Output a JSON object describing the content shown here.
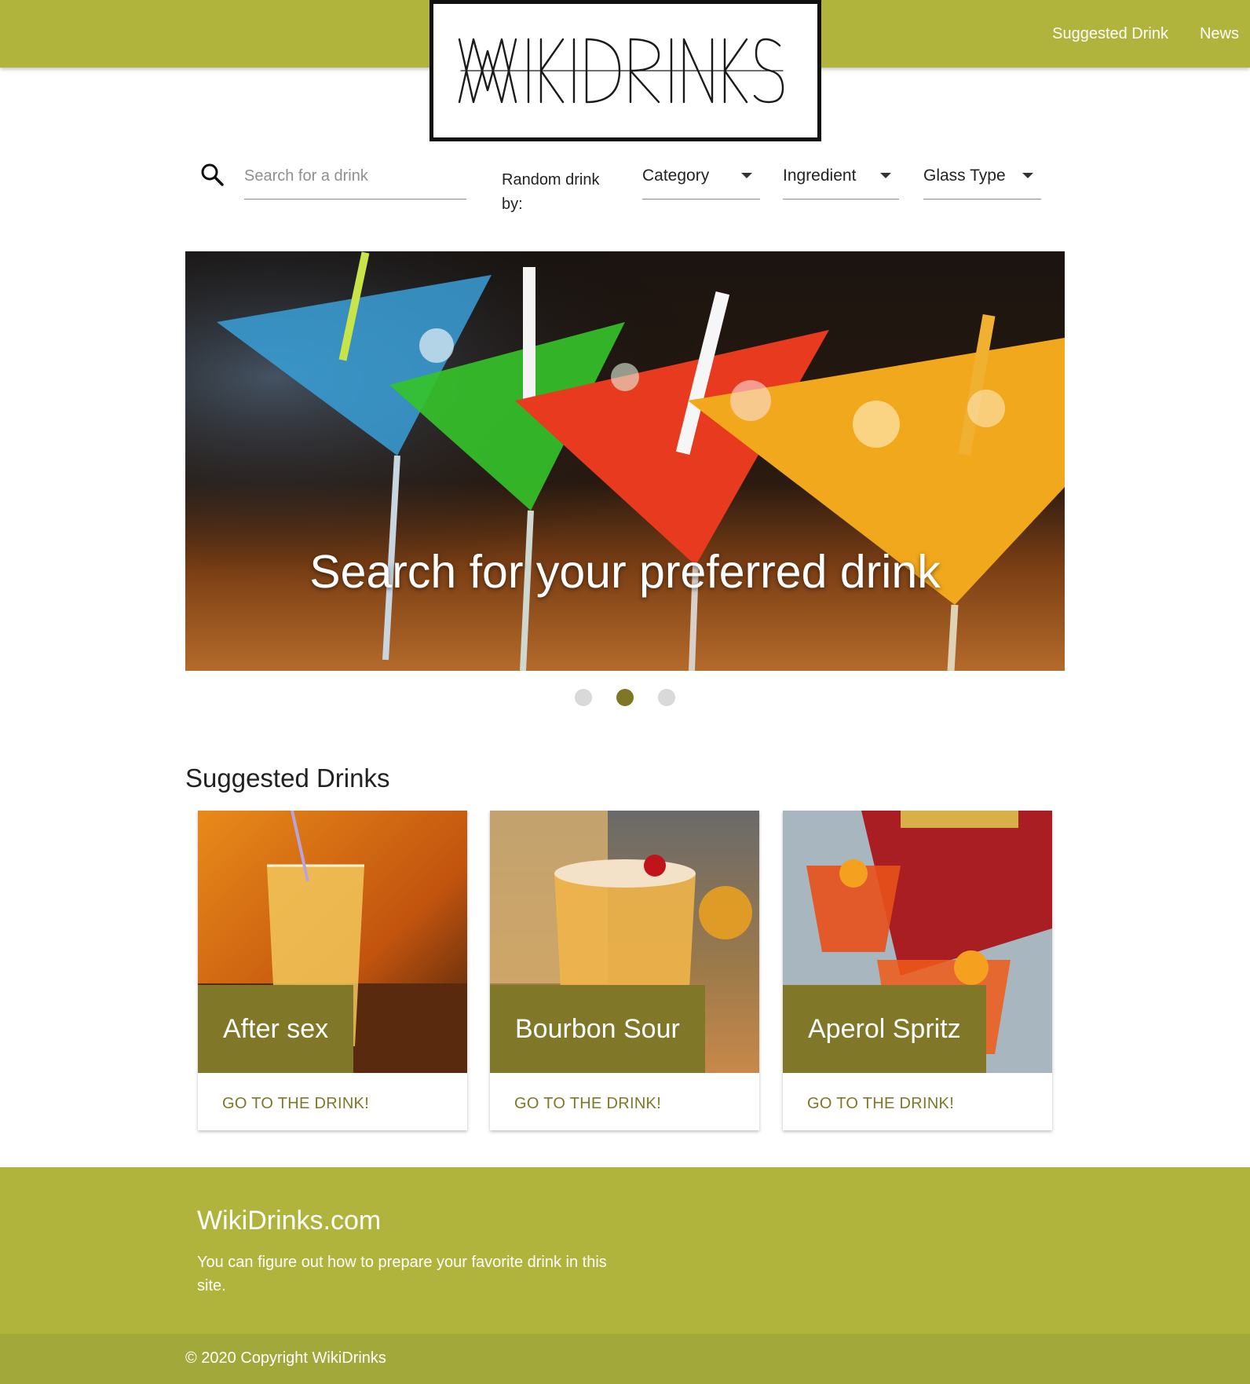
{
  "nav": {
    "links": [
      "Suggested Drink",
      "News"
    ]
  },
  "logo": {
    "text": "WIKIDRINKS"
  },
  "search": {
    "placeholder": "Search for a drink"
  },
  "random": {
    "label": "Random drink by:",
    "dropdowns": [
      "Category",
      "Ingredient",
      "Glass Type"
    ]
  },
  "hero": {
    "caption": "Search for your preferred drink",
    "slide_count": 3,
    "active_slide": 2
  },
  "suggested": {
    "title": "Suggested Drinks",
    "cards": [
      {
        "name": "After sex",
        "action": "GO TO THE DRINK!"
      },
      {
        "name": "Bourbon Sour",
        "action": "GO TO THE DRINK!"
      },
      {
        "name": "Aperol Spritz",
        "action": "GO TO THE DRINK!"
      }
    ]
  },
  "footer": {
    "title": "WikiDrinks.com",
    "text": "You can figure out how to prepare your favorite drink in this site.",
    "copyright": "© 2020 Copyright WikiDrinks"
  },
  "colors": {
    "brand": "#b0b43c",
    "accent_dark": "#817728",
    "copyright_bar": "#a3a83a"
  }
}
